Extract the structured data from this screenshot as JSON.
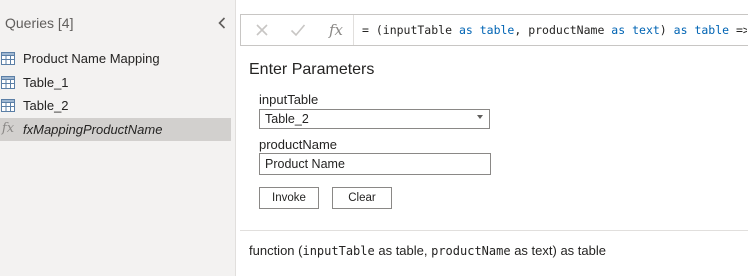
{
  "queries_pane": {
    "header": "Queries [4]",
    "collapse_icon": "chevron-left-icon",
    "items": [
      {
        "label": "Product Name Mapping",
        "icon": "table-icon",
        "selected": false
      },
      {
        "label": "Table_1",
        "icon": "table-icon",
        "selected": false
      },
      {
        "label": "Table_2",
        "icon": "table-icon",
        "selected": false
      },
      {
        "label": "fxMappingProductName",
        "icon": "function-icon",
        "selected": true
      }
    ]
  },
  "formula_bar": {
    "cancel_icon": "close-icon",
    "commit_icon": "checkmark-icon",
    "fx_label": "fx",
    "parts": {
      "p1": "= (inputTable ",
      "k1": "as",
      "p2": " ",
      "k2": "table",
      "p3": ", productName ",
      "k3": "as",
      "p4": " ",
      "k4": "text",
      "p5": ") ",
      "k5": "as",
      "p6": " ",
      "k6": "table",
      "p7": " =>  /"
    }
  },
  "parameters": {
    "title": "Enter Parameters",
    "input_table": {
      "label": "inputTable",
      "selected_value": "Table_2"
    },
    "product_name": {
      "label": "productName",
      "value": "Product Name"
    },
    "invoke_label": "Invoke",
    "clear_label": "Clear"
  },
  "signature": {
    "prefix": "function (",
    "param1": "inputTable",
    "type1": " as table, ",
    "param2": "productName",
    "type2": " as text) as table"
  },
  "colors": {
    "keyword": "#0064b4",
    "selected_row": "#d2d0ce",
    "pane_bg": "#f3f2f1"
  }
}
